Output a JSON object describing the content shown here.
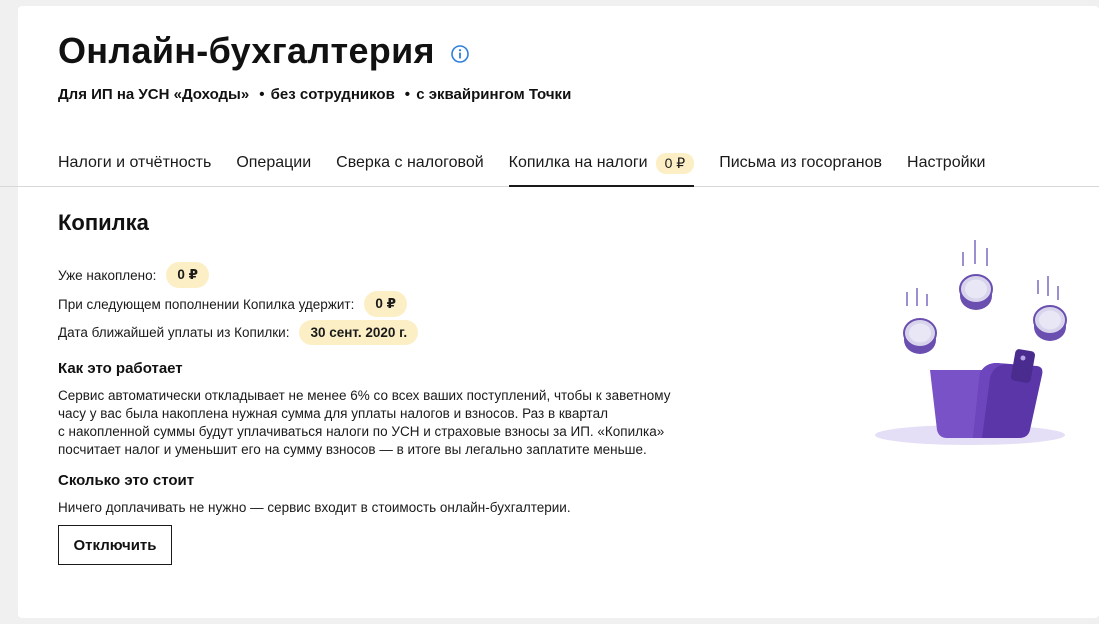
{
  "header": {
    "title": "Онлайн-бухгалтерия",
    "info_icon": "info-circle-icon",
    "tags": [
      "Для ИП на УСН «Доходы»",
      "без сотрудников",
      "с эквайрингом Точки"
    ]
  },
  "tabs": [
    {
      "label": "Налоги и отчётность",
      "active": false
    },
    {
      "label": "Операции",
      "active": false
    },
    {
      "label": "Сверка с налоговой",
      "active": false
    },
    {
      "label": "Копилка на налоги",
      "badge": "0 ₽",
      "active": true
    },
    {
      "label": "Письма из госорганов",
      "active": false
    },
    {
      "label": "Настройки",
      "active": false
    }
  ],
  "main": {
    "title": "Копилка",
    "stats": [
      {
        "label": "Уже накоплено:",
        "value": "0 ₽"
      },
      {
        "label": "При следующем пополнении Копилка удержит:",
        "value": "0 ₽"
      },
      {
        "label": "Дата ближайшей уплаты из Копилки:",
        "value": "30 сент. 2020 г."
      }
    ],
    "how_title": "Как это работает",
    "how_lines": [
      "Сервис автоматически откладывает не менее 6% со всех ваших поступлений, чтобы к заветному",
      "часу у вас была накоплена нужная сумма для уплаты налогов и взносов. Раз в квартал",
      "с накопленной суммы будут уплачиваться налоги по УСН и страховые взносы за ИП. «Копилка»",
      "посчитает налог и уменьшит его на сумму взносов — в итоге вы легально заплатите меньше."
    ],
    "cost_title": "Сколько это стоит",
    "cost_text": "Ничего доплачивать не нужно — сервис входит в стоимость онлайн-бухгалтерии.",
    "disable_button": "Отключить"
  },
  "colors": {
    "accent_purple": "#6a3fbf",
    "pill_bg": "#fcefc6",
    "info_blue": "#2f7fd8"
  }
}
